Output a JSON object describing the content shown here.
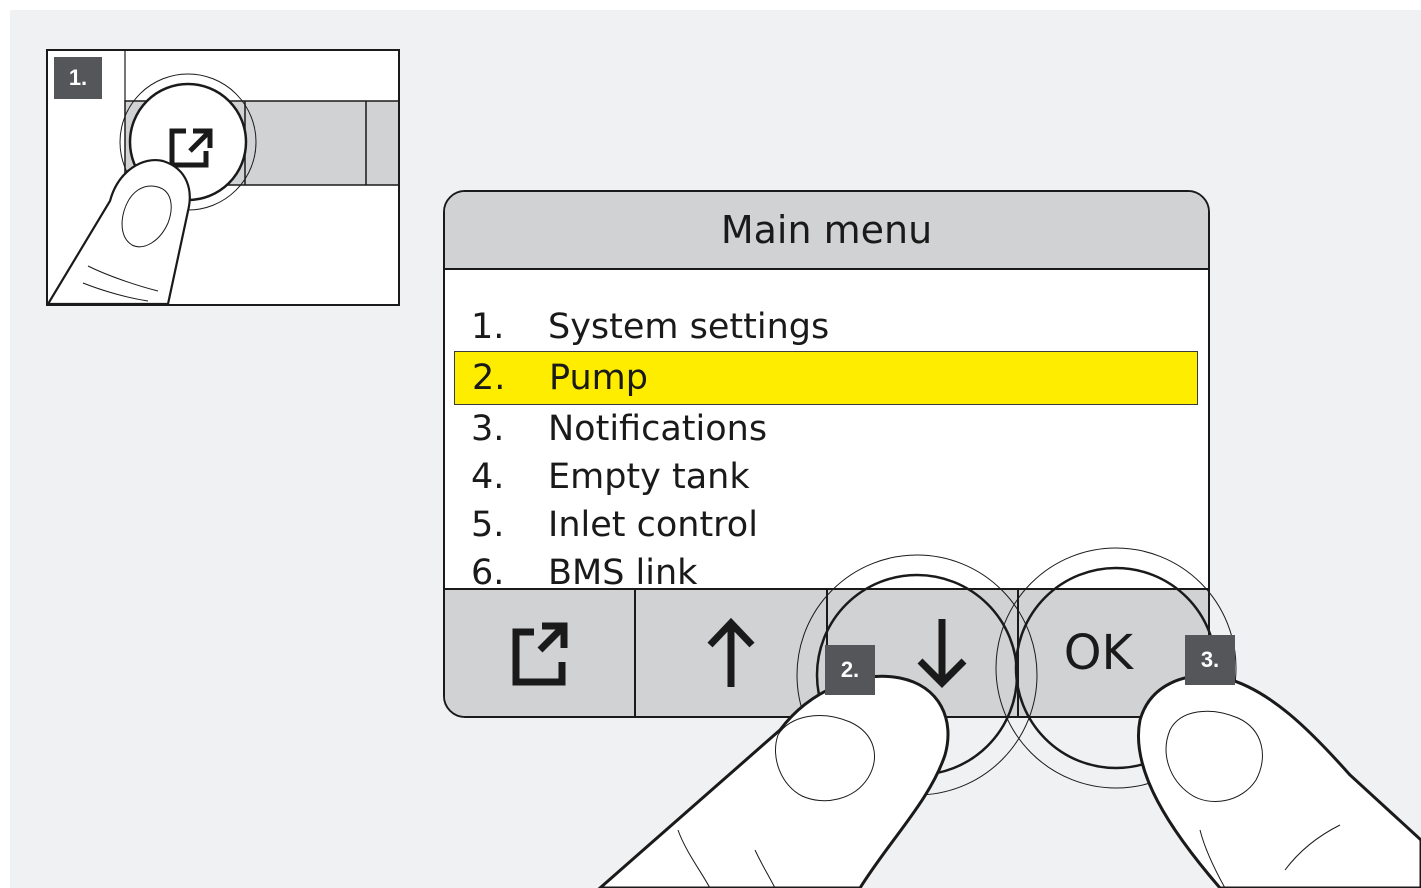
{
  "steps": {
    "step1": "1.",
    "step2": "2.",
    "step3": "3."
  },
  "display": {
    "title": "Main menu",
    "menu_items": [
      {
        "number": "1.",
        "label": "System settings",
        "selected": false
      },
      {
        "number": "2.",
        "label": "Pump",
        "selected": true
      },
      {
        "number": "3.",
        "label": "Notifications",
        "selected": false
      },
      {
        "number": "4.",
        "label": "Empty tank",
        "selected": false
      },
      {
        "number": "5.",
        "label": "Inlet control",
        "selected": false
      },
      {
        "number": "6.",
        "label": "BMS link",
        "selected": false
      }
    ],
    "softkeys": [
      {
        "icon": "menu-open-icon"
      },
      {
        "icon": "arrow-up-icon"
      },
      {
        "icon": "arrow-down-icon"
      },
      {
        "label": "OK"
      }
    ]
  },
  "colors": {
    "highlight": "#ffed00",
    "panel_gray": "#d1d2d4",
    "tag_gray": "#55565a",
    "background": "#f0f1f3"
  }
}
